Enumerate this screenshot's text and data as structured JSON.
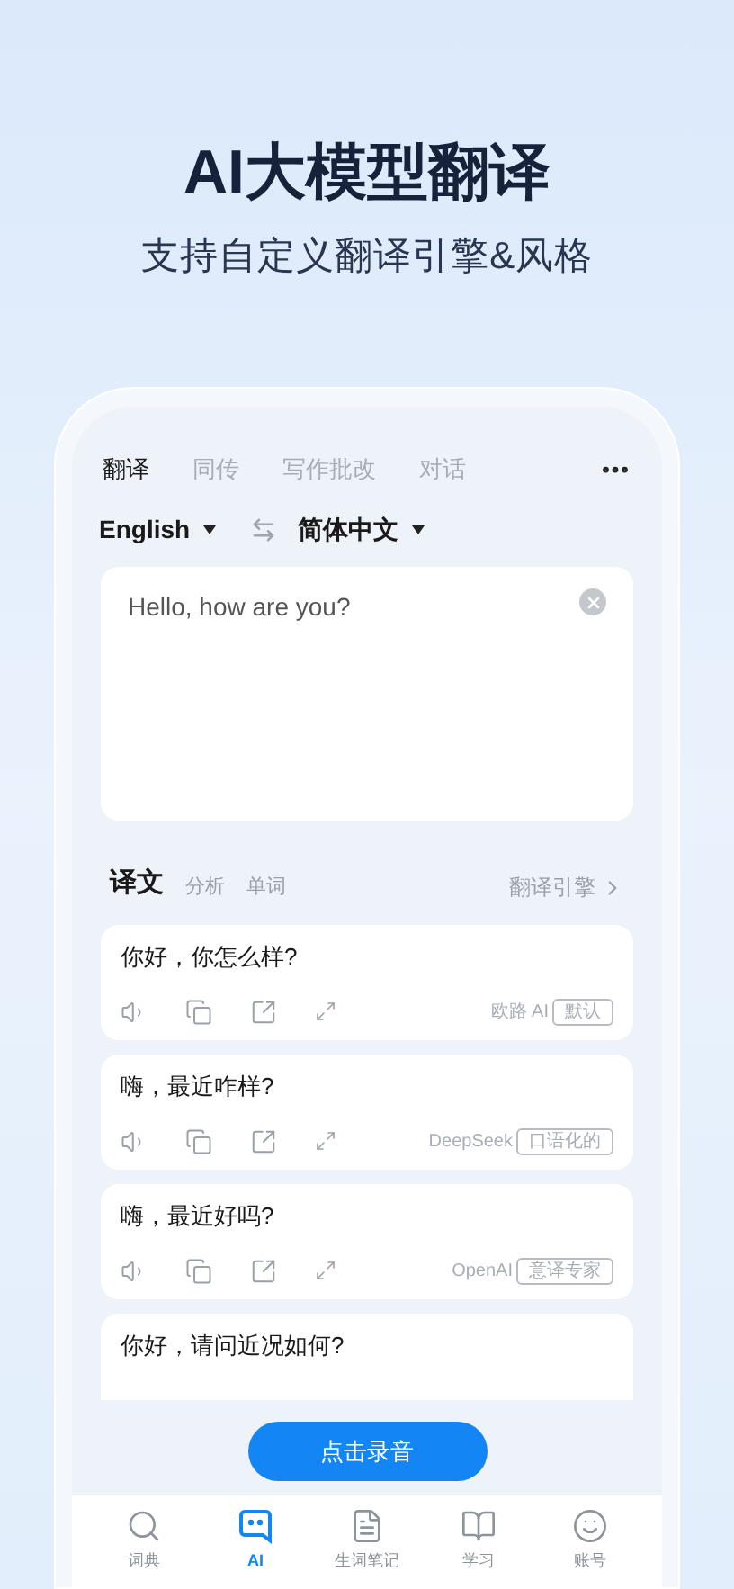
{
  "headline": "AI大模型翻译",
  "subheadline": "支持自定义翻译引擎&风格",
  "mode_tabs": [
    {
      "label": "翻译",
      "selected": true
    },
    {
      "label": "同传",
      "selected": false
    },
    {
      "label": "写作批改",
      "selected": false
    },
    {
      "label": "对话",
      "selected": false
    }
  ],
  "languages": {
    "source": "English",
    "target": "简体中文"
  },
  "input": {
    "value": "Hello, how are you?"
  },
  "result_tabs": [
    {
      "label": "译文",
      "selected": true
    },
    {
      "label": "分析",
      "selected": false
    },
    {
      "label": "单词",
      "selected": false
    }
  ],
  "engine_link": "翻译引擎",
  "results": [
    {
      "text": "你好，你怎么样?",
      "engine": "欧路 AI",
      "tag": "默认",
      "actions": true
    },
    {
      "text": "嗨，最近咋样?",
      "engine": "DeepSeek",
      "tag": "口语化的",
      "actions": true
    },
    {
      "text": "嗨，最近好吗?",
      "engine": "OpenAI",
      "tag": "意译专家",
      "actions": true
    },
    {
      "text": "你好，请问近况如何?",
      "actions": false
    }
  ],
  "record_button": "点击录音",
  "bottom_nav": [
    {
      "kind": "dictionary",
      "label": "词典",
      "selected": false
    },
    {
      "kind": "ai",
      "label": "AI",
      "selected": true
    },
    {
      "kind": "notes",
      "label": "生词笔记",
      "selected": false
    },
    {
      "kind": "study",
      "label": "学习",
      "selected": false
    },
    {
      "kind": "account",
      "label": "账号",
      "selected": false
    }
  ]
}
